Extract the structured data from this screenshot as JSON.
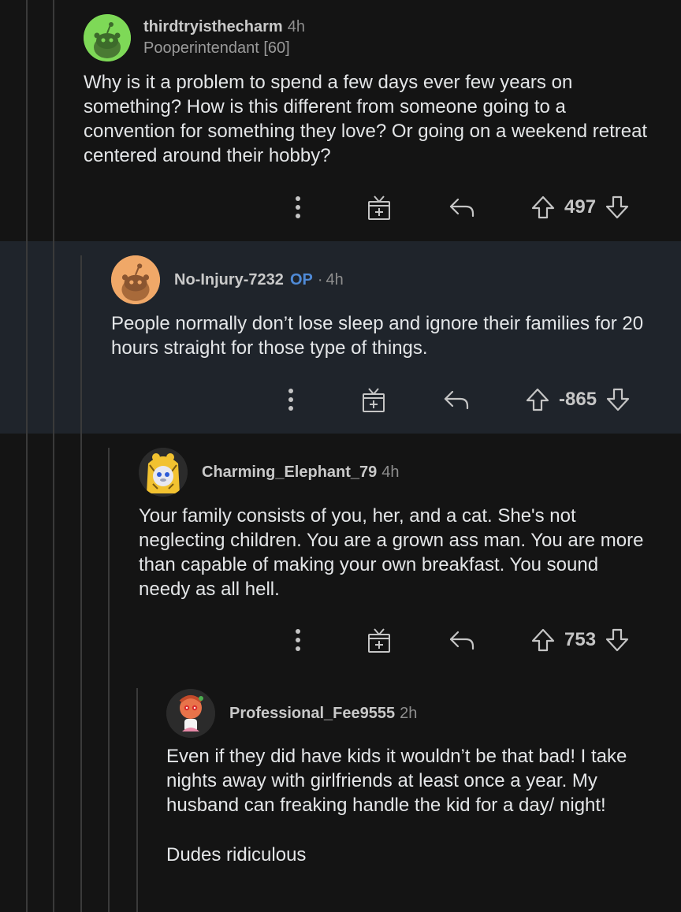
{
  "comments": [
    {
      "user": "thirdtryisthecharm",
      "time": "4h",
      "flair": "Pooperintendant [60]",
      "body": [
        "Why is it a problem to spend a few days ever few years on something? How is this different from someone going to a convention for something they love? Or going on a weekend retreat centered around their hobby?"
      ],
      "score": "497",
      "avatar_color": "#7ed957"
    },
    {
      "user": "No-Injury-7232",
      "op_label": "OP",
      "separator": "·",
      "time": "4h",
      "body": [
        "People normally don’t lose sleep and ignore their families for 20 hours straight for those type of things."
      ],
      "score": "-865",
      "avatar_color": "#f0a868"
    },
    {
      "user": "Charming_Elephant_79",
      "time": "4h",
      "body": [
        "Your family consists of you, her, and a cat. She's not neglecting children. You are a grown ass man. You are more than capable of making your own breakfast. You sound needy as all hell."
      ],
      "score": "753",
      "avatar_color": "#f2c230"
    },
    {
      "user": "Professional_Fee9555",
      "time": "2h",
      "body": [
        "Even if they did have kids it wouldn’t be that bad! I take nights away with girlfriends at least once a year. My husband can freaking handle the kid for a day/ night!",
        "Dudes ridiculous"
      ],
      "avatar_color": "#e8734a"
    }
  ],
  "icons": [
    "more-options-icon",
    "award-icon",
    "reply-icon",
    "upvote-icon",
    "downvote-icon"
  ],
  "colors": {
    "background": "#141414",
    "highlight": "#1f242b",
    "op": "#4f8ad6",
    "thread_line": "#3a3a3a"
  }
}
